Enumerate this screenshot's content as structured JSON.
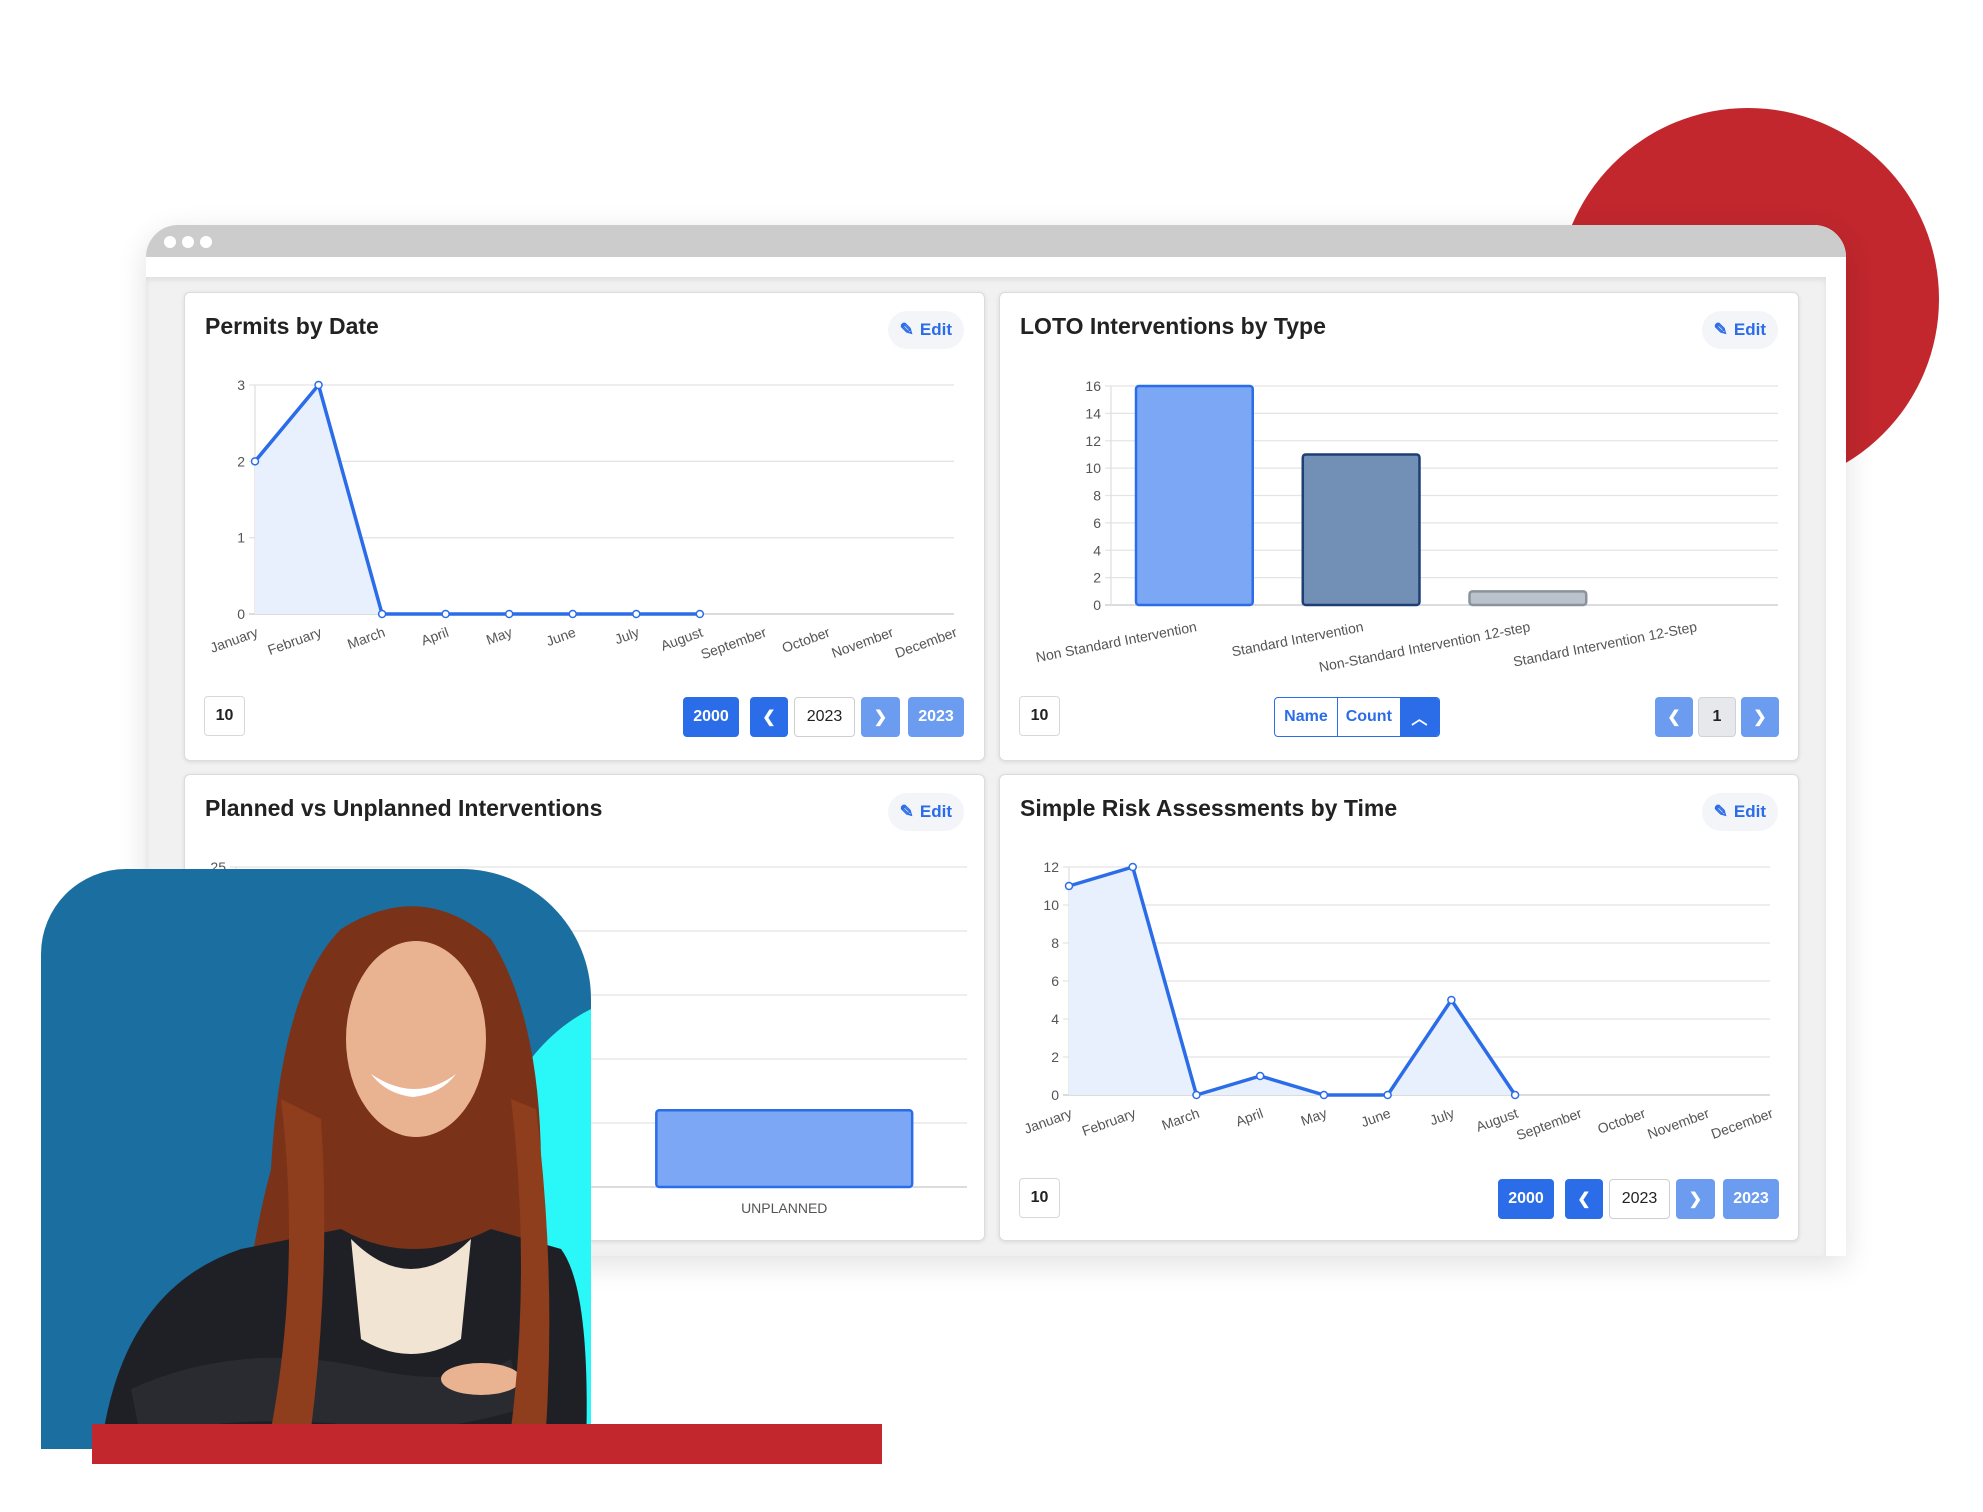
{
  "colors": {
    "brand_red": "#c1272d",
    "accent_blue": "#2b6de8",
    "light_blue": "#6c9cf0",
    "photo_bg": "#1b6fa0",
    "photo_accent": "#2af7f7"
  },
  "window": {
    "dots": 3
  },
  "edit_label": "Edit",
  "cards": {
    "permits": {
      "title": "Permits by Date",
      "page_size": "10",
      "buttons": {
        "start_year": "2000",
        "current_year": "2023",
        "end_year": "2023"
      }
    },
    "loto": {
      "title": "LOTO Interventions by Type",
      "page_size": "10",
      "sort": {
        "name": "Name",
        "count": "Count"
      },
      "page": "1"
    },
    "planned": {
      "title": "Planned vs Unplanned Interventions"
    },
    "risk": {
      "title": "Simple Risk Assessments by Time",
      "page_size": "10",
      "buttons": {
        "start_year": "2000",
        "current_year": "2023",
        "end_year": "2023"
      }
    }
  },
  "chart_data": [
    {
      "id": "permits",
      "type": "line",
      "title": "Permits by Date",
      "categories": [
        "January",
        "February",
        "March",
        "April",
        "May",
        "June",
        "July",
        "August",
        "September",
        "October",
        "November",
        "December"
      ],
      "values": [
        2,
        3,
        0,
        0,
        0,
        0,
        0,
        0
      ],
      "ylim": [
        0,
        3
      ],
      "yticks": [
        0,
        1,
        2,
        3
      ],
      "grid": true,
      "color": "#2b6de8",
      "fill": "#e8f0fd"
    },
    {
      "id": "loto",
      "type": "bar",
      "title": "LOTO Interventions by Type",
      "categories": [
        "Non Standard Intervention",
        "Standard Intervention",
        "Non-Standard Intervention 12-step",
        "Standard Intervention 12-Step"
      ],
      "values": [
        16,
        11,
        1,
        0
      ],
      "ylim": [
        0,
        16
      ],
      "yticks": [
        0,
        2,
        4,
        6,
        8,
        10,
        12,
        14,
        16
      ],
      "grid": true,
      "bar_colors": [
        "#7ba7f5",
        "#7290b5",
        "#bac2cc",
        "#e0e0e0"
      ],
      "bar_borders": [
        "#2b6de8",
        "#1e3f75",
        "#8a939c",
        "#aaaaaa"
      ]
    },
    {
      "id": "planned",
      "type": "bar",
      "title": "Planned vs Unplanned Interventions",
      "categories": [
        "UNPLANNED"
      ],
      "values": [
        6
      ],
      "ylim": [
        0,
        25
      ],
      "yticks": [
        0,
        5,
        10,
        15,
        20,
        25
      ],
      "grid": true,
      "bar_colors": [
        "#7ba7f5"
      ],
      "bar_borders": [
        "#2b6de8"
      ]
    },
    {
      "id": "risk",
      "type": "line",
      "title": "Simple Risk Assessments by Time",
      "categories": [
        "January",
        "February",
        "March",
        "April",
        "May",
        "June",
        "July",
        "August",
        "September",
        "October",
        "November",
        "December"
      ],
      "values": [
        11,
        12,
        0,
        1,
        0,
        0,
        5,
        0
      ],
      "ylim": [
        0,
        12
      ],
      "yticks": [
        0,
        2,
        4,
        6,
        8,
        10,
        12
      ],
      "grid": true,
      "color": "#2b6de8",
      "fill": "#e8f0fd"
    }
  ]
}
